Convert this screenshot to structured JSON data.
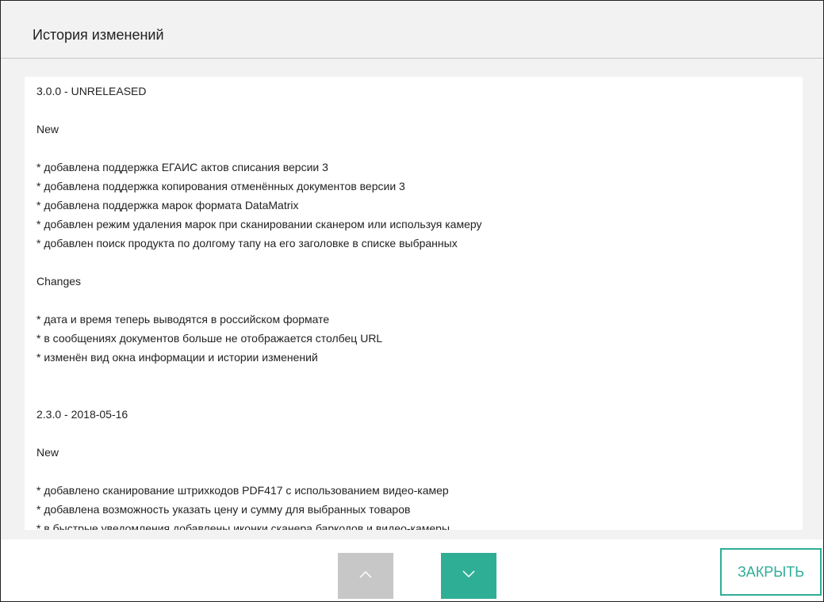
{
  "dialog": {
    "title": "История изменений"
  },
  "changelog": {
    "lines": [
      "3.0.0 - UNRELEASED",
      "",
      "New",
      "",
      "* добавлена поддержка ЕГАИС актов списания версии 3",
      "* добавлена поддержка копирования отменённых документов версии 3",
      "* добавлена поддержка марок формата DataMatrix",
      "* добавлен режим удаления марок при сканировании сканером или используя камеру",
      "* добавлен поиск продукта по долгому тапу на его заголовке в списке выбранных",
      "",
      "Changes",
      "",
      "* дата и время теперь выводятся в российском формате",
      "* в сообщениях документов больше не отображается столбец URL",
      "* изменён вид окна информации и истории изменений",
      "",
      "",
      "2.3.0 - 2018-05-16",
      "",
      "New",
      "",
      "* добавлено сканирование штрихкодов PDF417 с использованием видео-камер",
      "* добавлена возможность указать цену и сумму для выбранных товаров",
      "* в быстрые уведомления добавлены иконки сканера баркодов и видео-камеры"
    ]
  },
  "footer": {
    "close_label": "ЗАКРЫТЬ",
    "up_icon": "chevron-up-icon",
    "down_icon": "chevron-down-icon"
  },
  "colors": {
    "accent": "#2fae96",
    "disabled": "#c7c7c7"
  }
}
